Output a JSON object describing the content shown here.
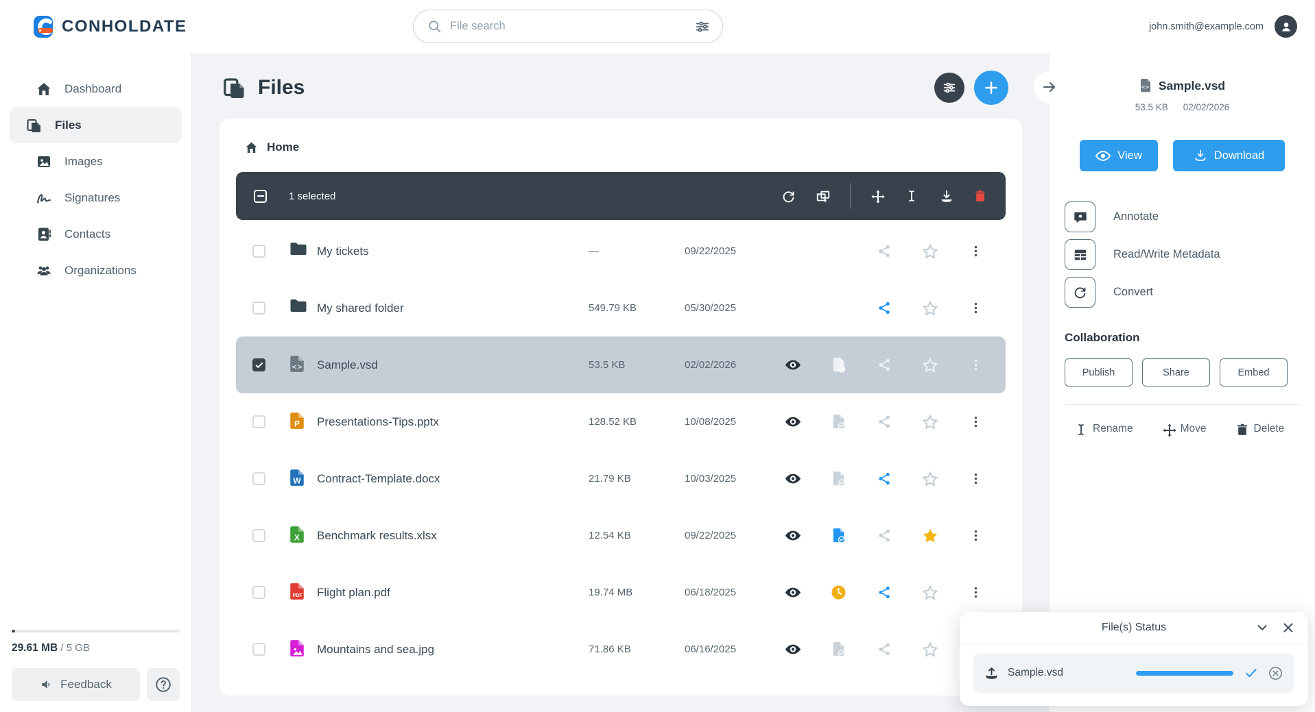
{
  "header": {
    "logo_text": "CONHOLDATE",
    "search_placeholder": "File search",
    "user_email": "john.smith@example.com"
  },
  "sidebar": {
    "items": [
      {
        "label": "Dashboard",
        "icon": "home",
        "active": false
      },
      {
        "label": "Files",
        "icon": "files",
        "active": true
      },
      {
        "label": "Images",
        "icon": "image",
        "active": false
      },
      {
        "label": "Signatures",
        "icon": "signature",
        "active": false
      },
      {
        "label": "Contacts",
        "icon": "contacts",
        "active": false
      },
      {
        "label": "Organizations",
        "icon": "people",
        "active": false
      }
    ],
    "storage": {
      "used": "29.61 MB",
      "total": "/ 5 GB",
      "percent": 2
    },
    "feedback_label": "Feedback"
  },
  "main": {
    "title": "Files",
    "breadcrumb": "Home",
    "toolbar": {
      "selected_text": "1 selected",
      "icons": [
        "refresh",
        "combine",
        "divider",
        "move",
        "rename",
        "download",
        "trash"
      ]
    },
    "files": [
      {
        "name": "My tickets",
        "type": "folder",
        "size": "—",
        "date": "09/22/2025",
        "selected": false,
        "eye": false,
        "status": "none",
        "share": "gray",
        "star": "outline"
      },
      {
        "name": "My shared folder",
        "type": "folder",
        "size": "549.79 KB",
        "date": "05/30/2025",
        "selected": false,
        "eye": false,
        "status": "none",
        "share": "blue",
        "star": "outline"
      },
      {
        "name": "Sample.vsd",
        "type": "vsd",
        "size": "53.5 KB",
        "date": "02/02/2026",
        "selected": true,
        "eye": true,
        "status": "doc-light",
        "share": "light",
        "star": "light"
      },
      {
        "name": "Presentations-Tips.pptx",
        "type": "pptx",
        "size": "128.52 KB",
        "date": "10/08/2025",
        "selected": false,
        "eye": true,
        "status": "doc-gray",
        "share": "gray",
        "star": "outline"
      },
      {
        "name": "Contract-Template.docx",
        "type": "docx",
        "size": "21.79 KB",
        "date": "10/03/2025",
        "selected": false,
        "eye": true,
        "status": "doc-gray",
        "share": "blue",
        "star": "outline"
      },
      {
        "name": "Benchmark results.xlsx",
        "type": "xlsx",
        "size": "12.54 KB",
        "date": "09/22/2025",
        "selected": false,
        "eye": true,
        "status": "doc-blue",
        "share": "gray",
        "star": "filled"
      },
      {
        "name": "Flight plan.pdf",
        "type": "pdf",
        "size": "19.74 MB",
        "date": "06/18/2025",
        "selected": false,
        "eye": true,
        "status": "clock",
        "share": "blue",
        "star": "outline"
      },
      {
        "name": "Mountains and sea.jpg",
        "type": "jpg",
        "size": "71.86 KB",
        "date": "06/16/2025",
        "selected": false,
        "eye": true,
        "status": "doc-gray",
        "share": "gray",
        "star": "outline"
      }
    ]
  },
  "details": {
    "file_name": "Sample.vsd",
    "file_size": "53.5 KB",
    "file_date": "02/02/2026",
    "view_label": "View",
    "download_label": "Download",
    "actions": [
      {
        "label": "Annotate",
        "icon": "bubble"
      },
      {
        "label": "Read/Write Metadata",
        "icon": "table"
      },
      {
        "label": "Convert",
        "icon": "refresh"
      }
    ],
    "collaboration_title": "Collaboration",
    "collab_buttons": [
      {
        "label": "Publish"
      },
      {
        "label": "Share"
      },
      {
        "label": "Embed"
      }
    ],
    "footer_actions": [
      {
        "label": "Rename",
        "icon": "rename"
      },
      {
        "label": "Move",
        "icon": "move"
      },
      {
        "label": "Delete",
        "icon": "trash"
      }
    ]
  },
  "status_popup": {
    "title": "File(s) Status",
    "item_name": "Sample.vsd",
    "progress_percent": 100
  },
  "colors": {
    "accent_blue": "#2f9ded",
    "dark_slate": "#37424d",
    "danger_red": "#e8473f",
    "star_yellow": "#f7b50c",
    "clock_yellow": "#f2af13",
    "share_blue": "#2196f3",
    "muted_gray": "#c3ccd3",
    "folder": "#37474f",
    "vsd": "#6d7a84",
    "pptx": "#dd8e13",
    "docx": "#2372ba",
    "xlsx": "#3da135",
    "pdf": "#e03c31",
    "jpg": "#d61fd6"
  }
}
